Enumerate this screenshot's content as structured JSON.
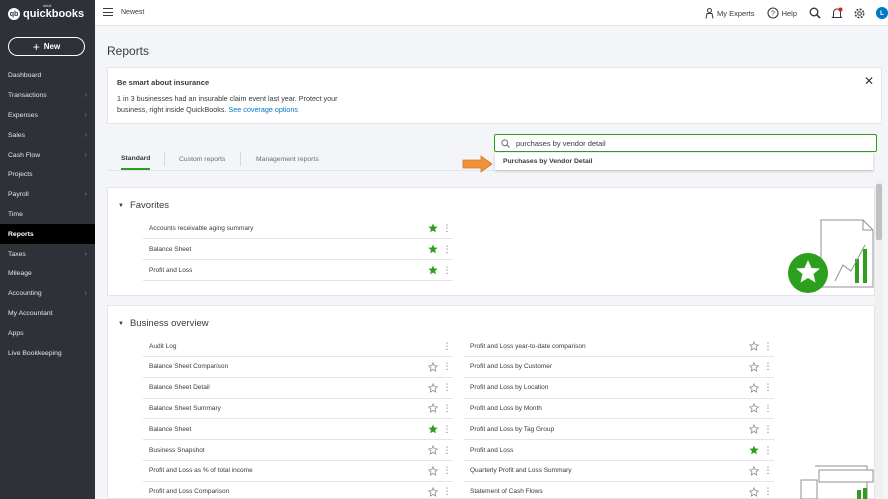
{
  "brand": {
    "small": "intuit",
    "name": "quickbooks"
  },
  "sidebar": {
    "new_label": "New",
    "items": [
      {
        "label": "Dashboard",
        "chevron": false
      },
      {
        "label": "Transactions",
        "chevron": true
      },
      {
        "label": "Expenses",
        "chevron": true
      },
      {
        "label": "Sales",
        "chevron": true
      },
      {
        "label": "Cash Flow",
        "chevron": true
      },
      {
        "label": "Projects",
        "chevron": false
      },
      {
        "label": "Payroll",
        "chevron": true
      },
      {
        "label": "Time",
        "chevron": false
      },
      {
        "label": "Reports",
        "chevron": false,
        "active": true
      },
      {
        "label": "Taxes",
        "chevron": true
      },
      {
        "label": "Mileage",
        "chevron": false
      },
      {
        "label": "Accounting",
        "chevron": true
      },
      {
        "label": "My Accountant",
        "chevron": false
      },
      {
        "label": "Apps",
        "chevron": false
      },
      {
        "label": "Live Bookkeeping",
        "chevron": false
      }
    ]
  },
  "topbar": {
    "company": "Newest",
    "my_experts": "My Experts",
    "help": "Help",
    "avatar_initial": "L"
  },
  "page": {
    "title": "Reports"
  },
  "banner": {
    "title": "Be smart about insurance",
    "text": "1 in 3 businesses had an insurable claim event last year. Protect your business, right inside QuickBooks.",
    "link": "See coverage options"
  },
  "tabs": [
    {
      "label": "Standard",
      "selected": true
    },
    {
      "label": "Custom reports",
      "selected": false
    },
    {
      "label": "Management reports",
      "selected": false
    }
  ],
  "search": {
    "value": "purchases by vendor detail",
    "suggestion": "Purchases by Vendor Detail"
  },
  "favorites": {
    "title": "Favorites",
    "items": [
      {
        "label": "Accounts receivable aging summary",
        "fav": true
      },
      {
        "label": "Balance Sheet",
        "fav": true
      },
      {
        "label": "Profit and Loss",
        "fav": true
      }
    ]
  },
  "business_overview": {
    "title": "Business overview",
    "left": [
      {
        "label": "Audit Log",
        "fav": false,
        "hide_star": true
      },
      {
        "label": "Balance Sheet Comparison",
        "fav": false
      },
      {
        "label": "Balance Sheet Detail",
        "fav": false
      },
      {
        "label": "Balance Sheet Summary",
        "fav": false
      },
      {
        "label": "Balance Sheet",
        "fav": true
      },
      {
        "label": "Business Snapshot",
        "fav": false
      },
      {
        "label": "Profit and Loss as % of total income",
        "fav": false
      },
      {
        "label": "Profit and Loss Comparison",
        "fav": false
      }
    ],
    "right": [
      {
        "label": "Profit and Loss year-to-date comparison",
        "fav": false
      },
      {
        "label": "Profit and Loss by Customer",
        "fav": false
      },
      {
        "label": "Profit and Loss by Location",
        "fav": false
      },
      {
        "label": "Profit and Loss by Month",
        "fav": false
      },
      {
        "label": "Profit and Loss by Tag Group",
        "fav": false
      },
      {
        "label": "Profit and Loss",
        "fav": true
      },
      {
        "label": "Quarterly Profit and Loss Summary",
        "fav": false
      },
      {
        "label": "Statement of Cash Flows",
        "fav": false
      }
    ]
  },
  "colors": {
    "accent": "#2ca01c",
    "link": "#0077c5",
    "sidebar": "#2e3137",
    "arrow": "#f0923a"
  }
}
